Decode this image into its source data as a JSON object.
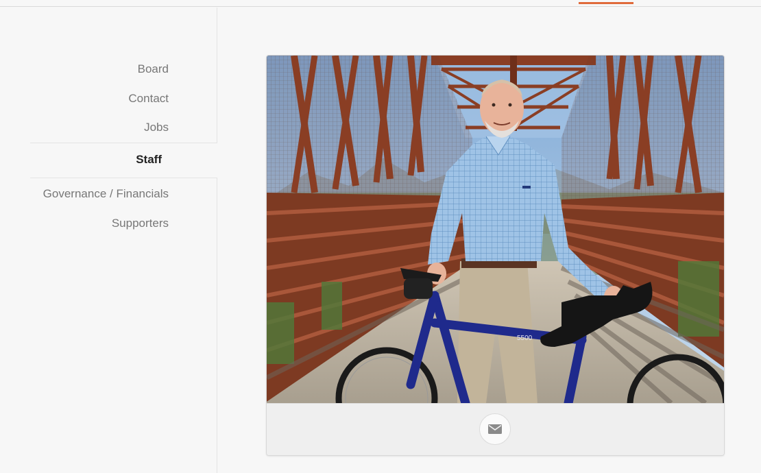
{
  "nav": {
    "items": [
      {
        "label": "Board"
      },
      {
        "label": "Contact"
      },
      {
        "label": "Jobs"
      },
      {
        "label": "Staff",
        "active": true
      },
      {
        "label": "Governance / Financials"
      },
      {
        "label": "Supporters"
      }
    ]
  },
  "colors": {
    "accent": "#e06a3a",
    "background": "#f7f7f7",
    "active_text": "#222222",
    "muted_text": "#777777"
  },
  "staff_card": {
    "photo_alt": "Staff member standing with a blue bicycle on a steel truss bridge",
    "bike_brand_label": "5500",
    "action_icon": "email-icon"
  }
}
